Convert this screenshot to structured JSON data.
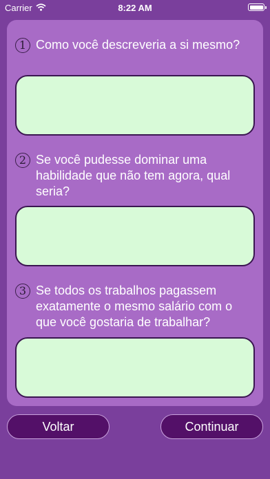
{
  "status_bar": {
    "carrier": "Carrier",
    "time": "8:22 AM",
    "battery_level": 1.0
  },
  "questions": [
    {
      "number": "1",
      "text": "Como você descreveria a si mesmo?",
      "answer": ""
    },
    {
      "number": "2",
      "text": "Se você pudesse dominar uma habilidade que não tem agora, qual seria?",
      "answer": ""
    },
    {
      "number": "3",
      "text": "Se todos os trabalhos pagassem exatamente o mesmo salário com o que você gostaria de trabalhar?",
      "answer": ""
    }
  ],
  "buttons": {
    "back_label": "Voltar",
    "continue_label": "Continuar"
  },
  "colors": {
    "background": "#7a3f9c",
    "card": "#a86bc6",
    "answer_field": "#d8fad8",
    "button": "#531068"
  }
}
